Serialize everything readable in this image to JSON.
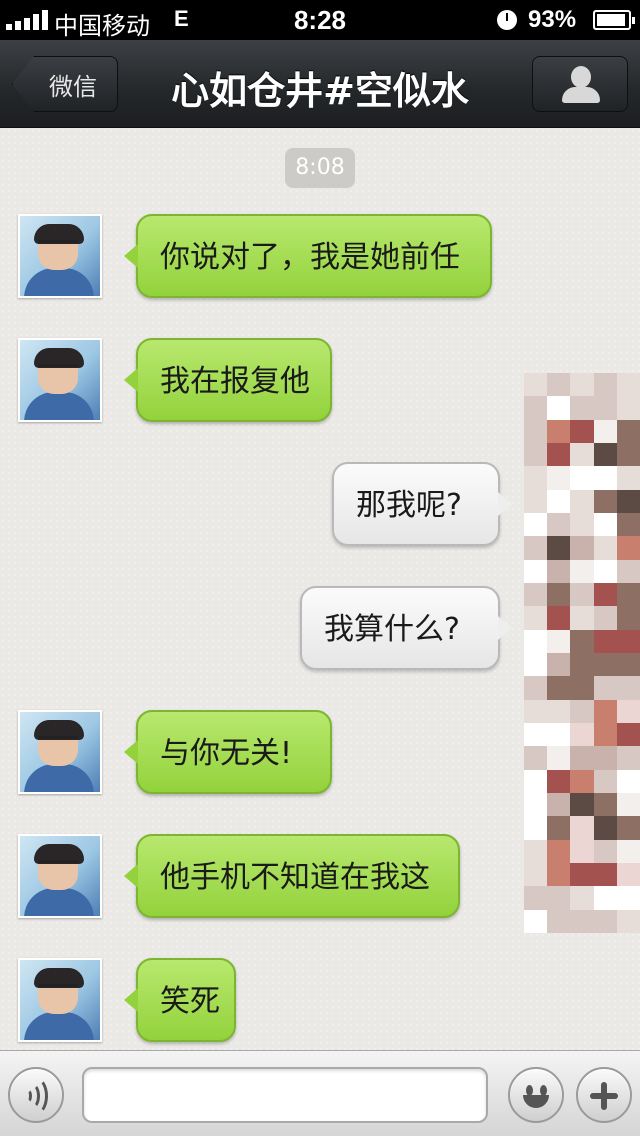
{
  "status_bar": {
    "carrier": "中国移动",
    "network": "E",
    "time": "8:28",
    "battery_percent": "93%",
    "battery_level": 0.93,
    "signal_bars": 5
  },
  "nav": {
    "back_label": "微信",
    "title": "心如仓井#空似水",
    "profile_icon": "person-icon"
  },
  "chat": {
    "timestamp": "8:08",
    "messages": [
      {
        "side": "in",
        "text": "你说对了，我是她前任"
      },
      {
        "side": "in",
        "text": "我在报复他"
      },
      {
        "side": "out",
        "text": "那我呢?"
      },
      {
        "side": "out",
        "text": "我算什么?"
      },
      {
        "side": "in",
        "text": "与你无关!"
      },
      {
        "side": "in",
        "text": "他手机不知道在我这"
      },
      {
        "side": "in",
        "text": "笑死"
      }
    ]
  },
  "input_bar": {
    "voice_icon": "voice-icon",
    "input_value": "",
    "emoji_icon": "smiley-icon",
    "plus_icon": "plus-icon"
  },
  "colors": {
    "incoming_bubble": "#9ed64a",
    "outgoing_bubble": "#f2f2f2",
    "nav_bar": "#26292c",
    "chat_background": "#ebe9e6"
  }
}
